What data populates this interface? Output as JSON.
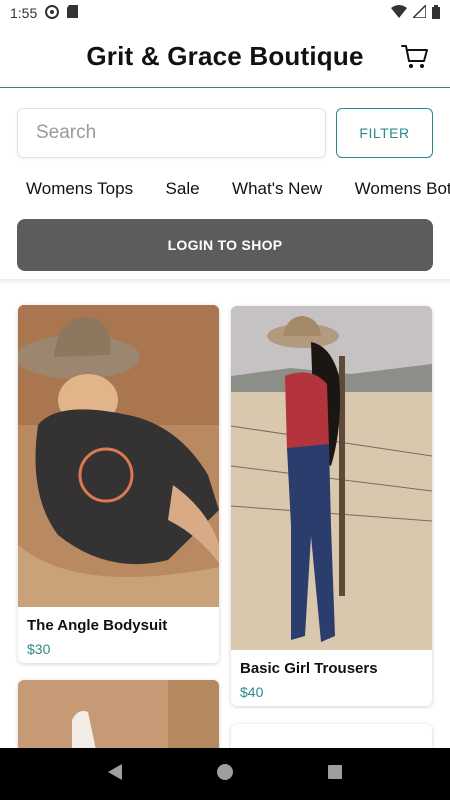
{
  "status_bar": {
    "time": "1:55"
  },
  "header": {
    "title": "Grit & Grace Boutique"
  },
  "search": {
    "placeholder": "Search",
    "value": ""
  },
  "filter": {
    "label": "FILTER"
  },
  "categories": [
    "Womens Tops",
    "Sale",
    "What's New",
    "Womens Bottoms"
  ],
  "login": {
    "label": "LOGIN TO SHOP"
  },
  "products": [
    {
      "name": "The Angle Bodysuit",
      "price": "$30"
    },
    {
      "name": "Basic Girl Trousers",
      "price": "$40"
    }
  ],
  "colors": {
    "accent": "#2d8a8a",
    "login_bg": "#5c5c5c",
    "nav_bg": "#000000"
  }
}
